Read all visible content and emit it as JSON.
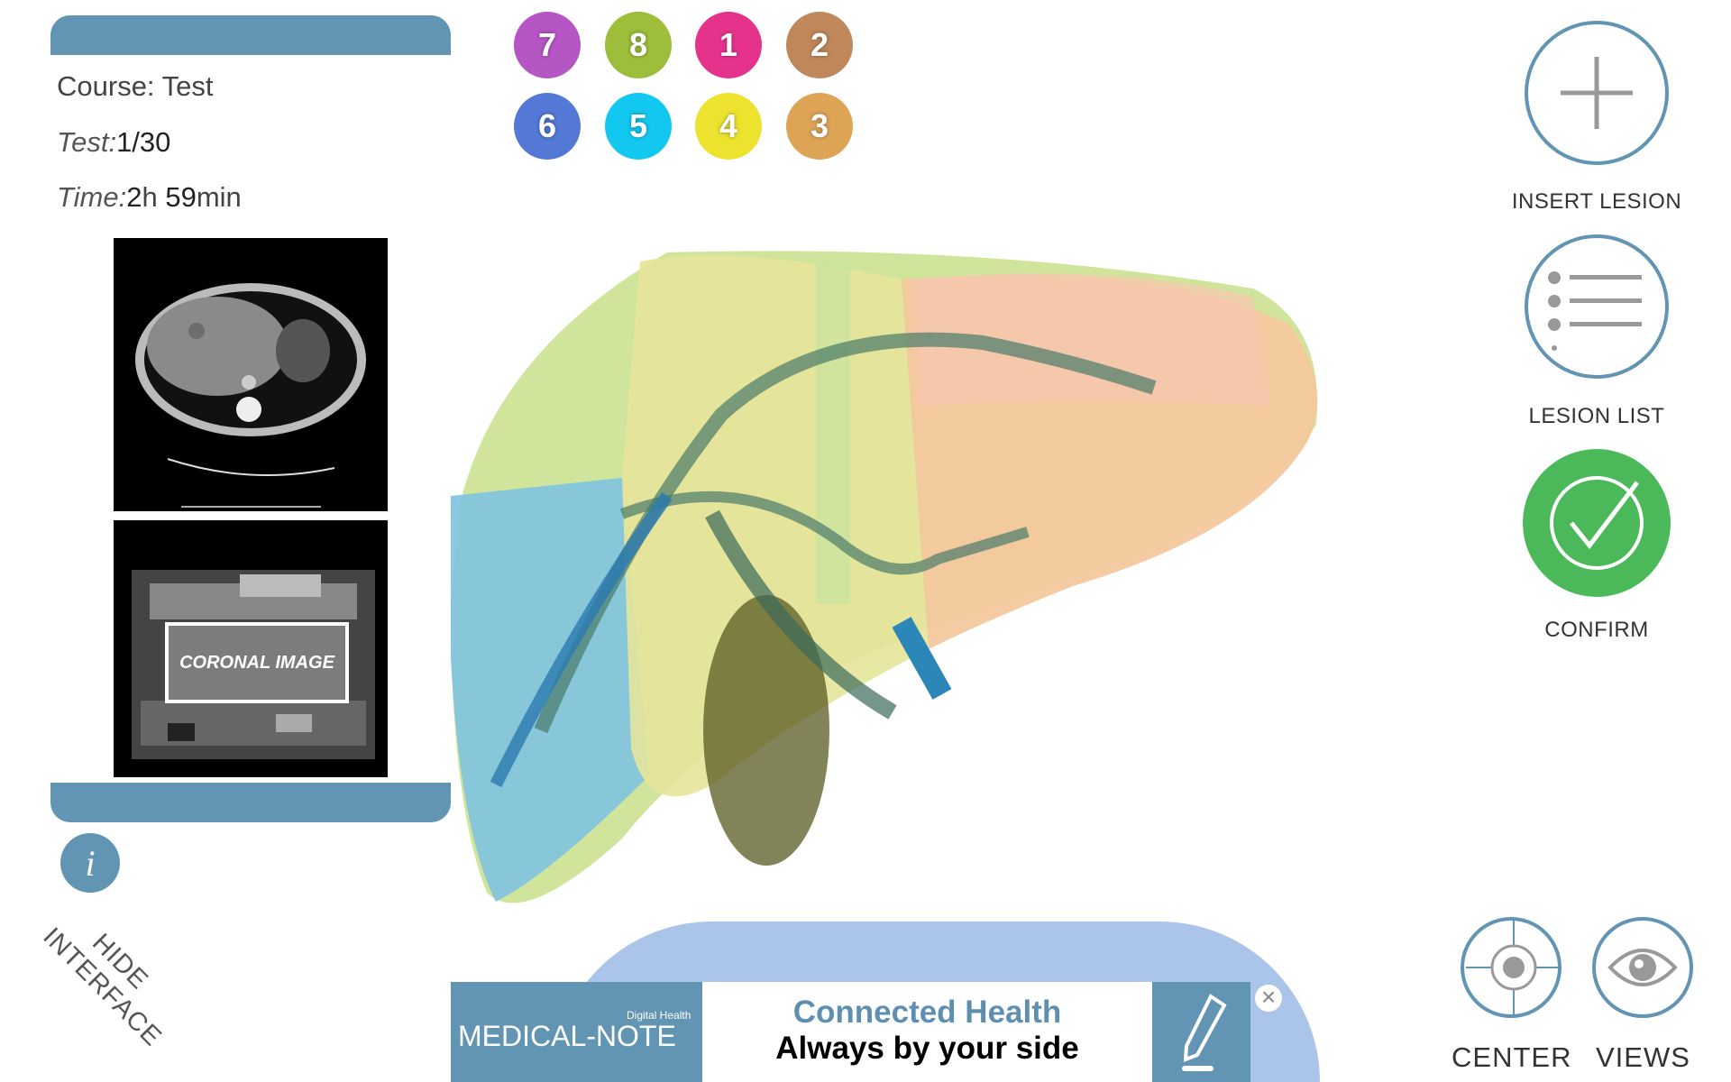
{
  "header": {
    "course_label": "Course: Test",
    "test_label": "Test:",
    "test_value": "1/30",
    "time_label": "Time:",
    "time_hours": "2",
    "time_h_unit": "h",
    "time_minutes": "59",
    "time_min_unit": "min"
  },
  "images": {
    "coronal_label": "CORONAL IMAGE"
  },
  "segments": [
    {
      "label": "7",
      "color": "#b556c4"
    },
    {
      "label": "8",
      "color": "#9cbe3a"
    },
    {
      "label": "1",
      "color": "#e5338c"
    },
    {
      "label": "2",
      "color": "#c0875a"
    },
    {
      "label": "6",
      "color": "#5378d6"
    },
    {
      "label": "5",
      "color": "#12c8f0"
    },
    {
      "label": "4",
      "color": "#ede22e"
    },
    {
      "label": "3",
      "color": "#dda456"
    }
  ],
  "actions": {
    "insert_lesion": "INSERT LESION",
    "lesion_list": "LESION LIST",
    "confirm": "CONFIRM",
    "center": "CENTER",
    "views": "VIEWS",
    "hide_interface_1": "HIDE",
    "hide_interface_2": "INTERFACE",
    "info": "i"
  },
  "ad": {
    "brand": "MEDICAL-NOTE",
    "brand_sub": "Digital Health",
    "headline": "Connected Health",
    "tagline": "Always by your side",
    "close": "×"
  },
  "colors": {
    "accent": "#6294b4",
    "confirm": "#4bb95a"
  }
}
